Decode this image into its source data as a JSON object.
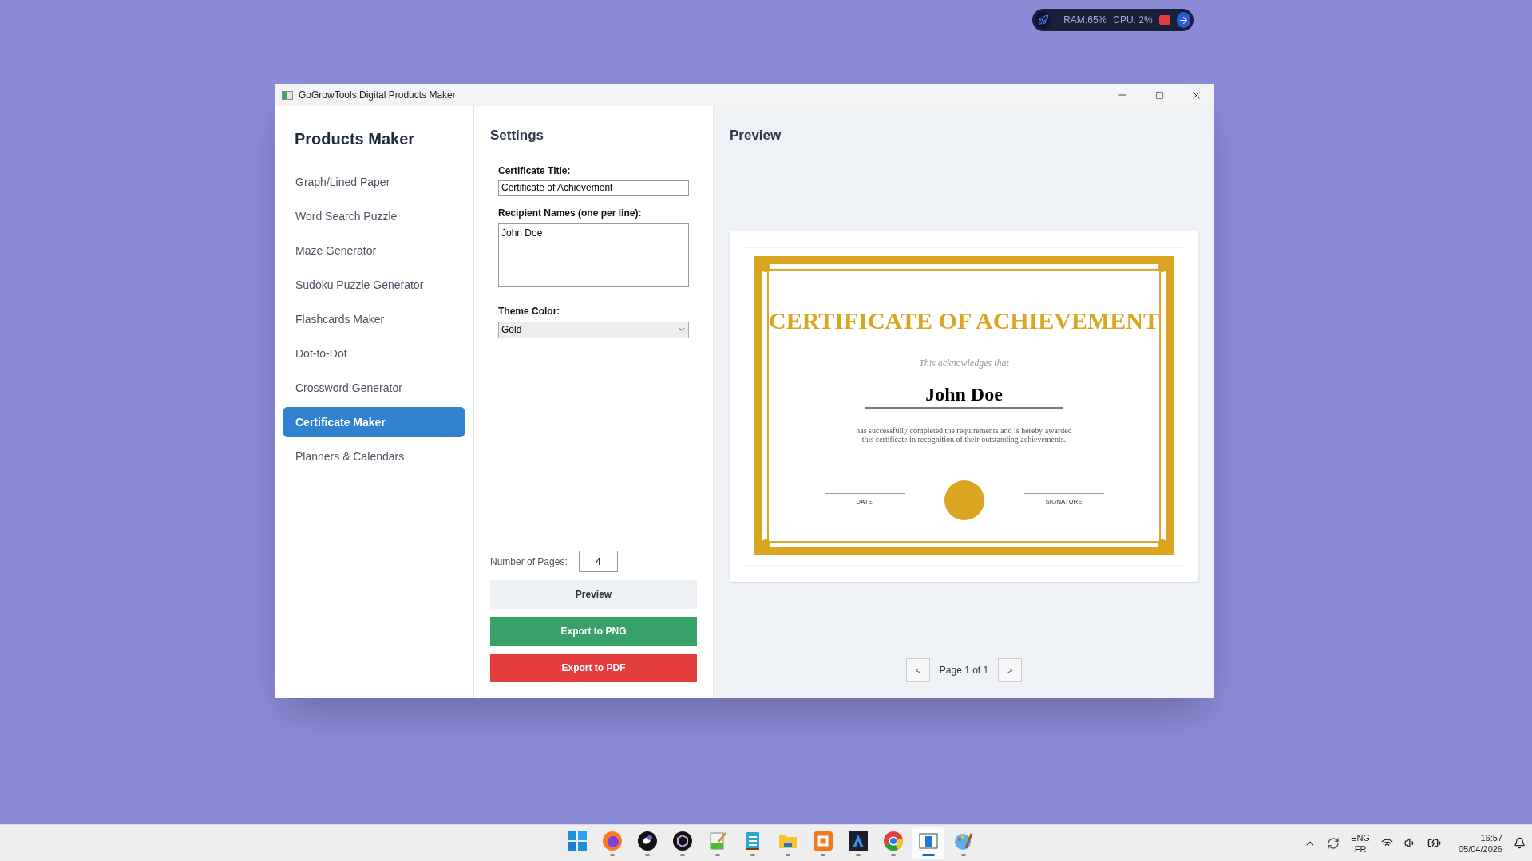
{
  "monitor_widget": {
    "ram": "RAM:65%",
    "cpu": "CPU: 2%"
  },
  "window": {
    "title": "GoGrowTools Digital Products Maker"
  },
  "sidebar": {
    "title": "Products Maker",
    "items": [
      {
        "label": "Graph/Lined Paper",
        "selected": false
      },
      {
        "label": "Word Search Puzzle",
        "selected": false
      },
      {
        "label": "Maze Generator",
        "selected": false
      },
      {
        "label": "Sudoku Puzzle Generator",
        "selected": false
      },
      {
        "label": "Flashcards Maker",
        "selected": false
      },
      {
        "label": "Dot-to-Dot",
        "selected": false
      },
      {
        "label": "Crossword Generator",
        "selected": false
      },
      {
        "label": "Certificate Maker",
        "selected": true
      },
      {
        "label": "Planners & Calendars",
        "selected": false
      }
    ]
  },
  "settings": {
    "title": "Settings",
    "certificate_title": {
      "label": "Certificate Title:",
      "value": "Certificate of Achievement"
    },
    "recipient_names": {
      "label": "Recipient Names (one per line):",
      "value": "John Doe"
    },
    "theme_color": {
      "label": "Theme Color:",
      "value": "Gold"
    },
    "number_of_pages": {
      "label": "Number of Pages:",
      "value": "4"
    },
    "buttons": [
      "Preview",
      "Export to PNG",
      "Export to PDF"
    ]
  },
  "preview": {
    "title": "Preview",
    "certificate": {
      "heading": "CERTIFICATE OF ACHIEVEMENT",
      "intro": "This acknowledges that",
      "recipient": "John Doe",
      "body": [
        "has successfully completed the requirements and is hereby awarded",
        "this certificate in recognition of their outstanding achievements."
      ],
      "date_label": "DATE",
      "signature_label": "SIGNATURE"
    },
    "pager": {
      "prev": "<",
      "label": "Page 1 of 1",
      "next": ">"
    }
  },
  "taskbar": {
    "apps": [
      {
        "selected": false
      },
      {
        "selected": false
      },
      {
        "selected": false
      },
      {
        "selected": false
      },
      {
        "selected": false
      },
      {
        "selected": false
      },
      {
        "selected": false
      },
      {
        "selected": false
      },
      {
        "selected": false
      },
      {
        "selected": false
      },
      {
        "selected": true
      },
      {
        "selected": false
      }
    ],
    "language": "ENG",
    "layout": "FR",
    "time": "16:57",
    "date": "05/04/2026"
  }
}
